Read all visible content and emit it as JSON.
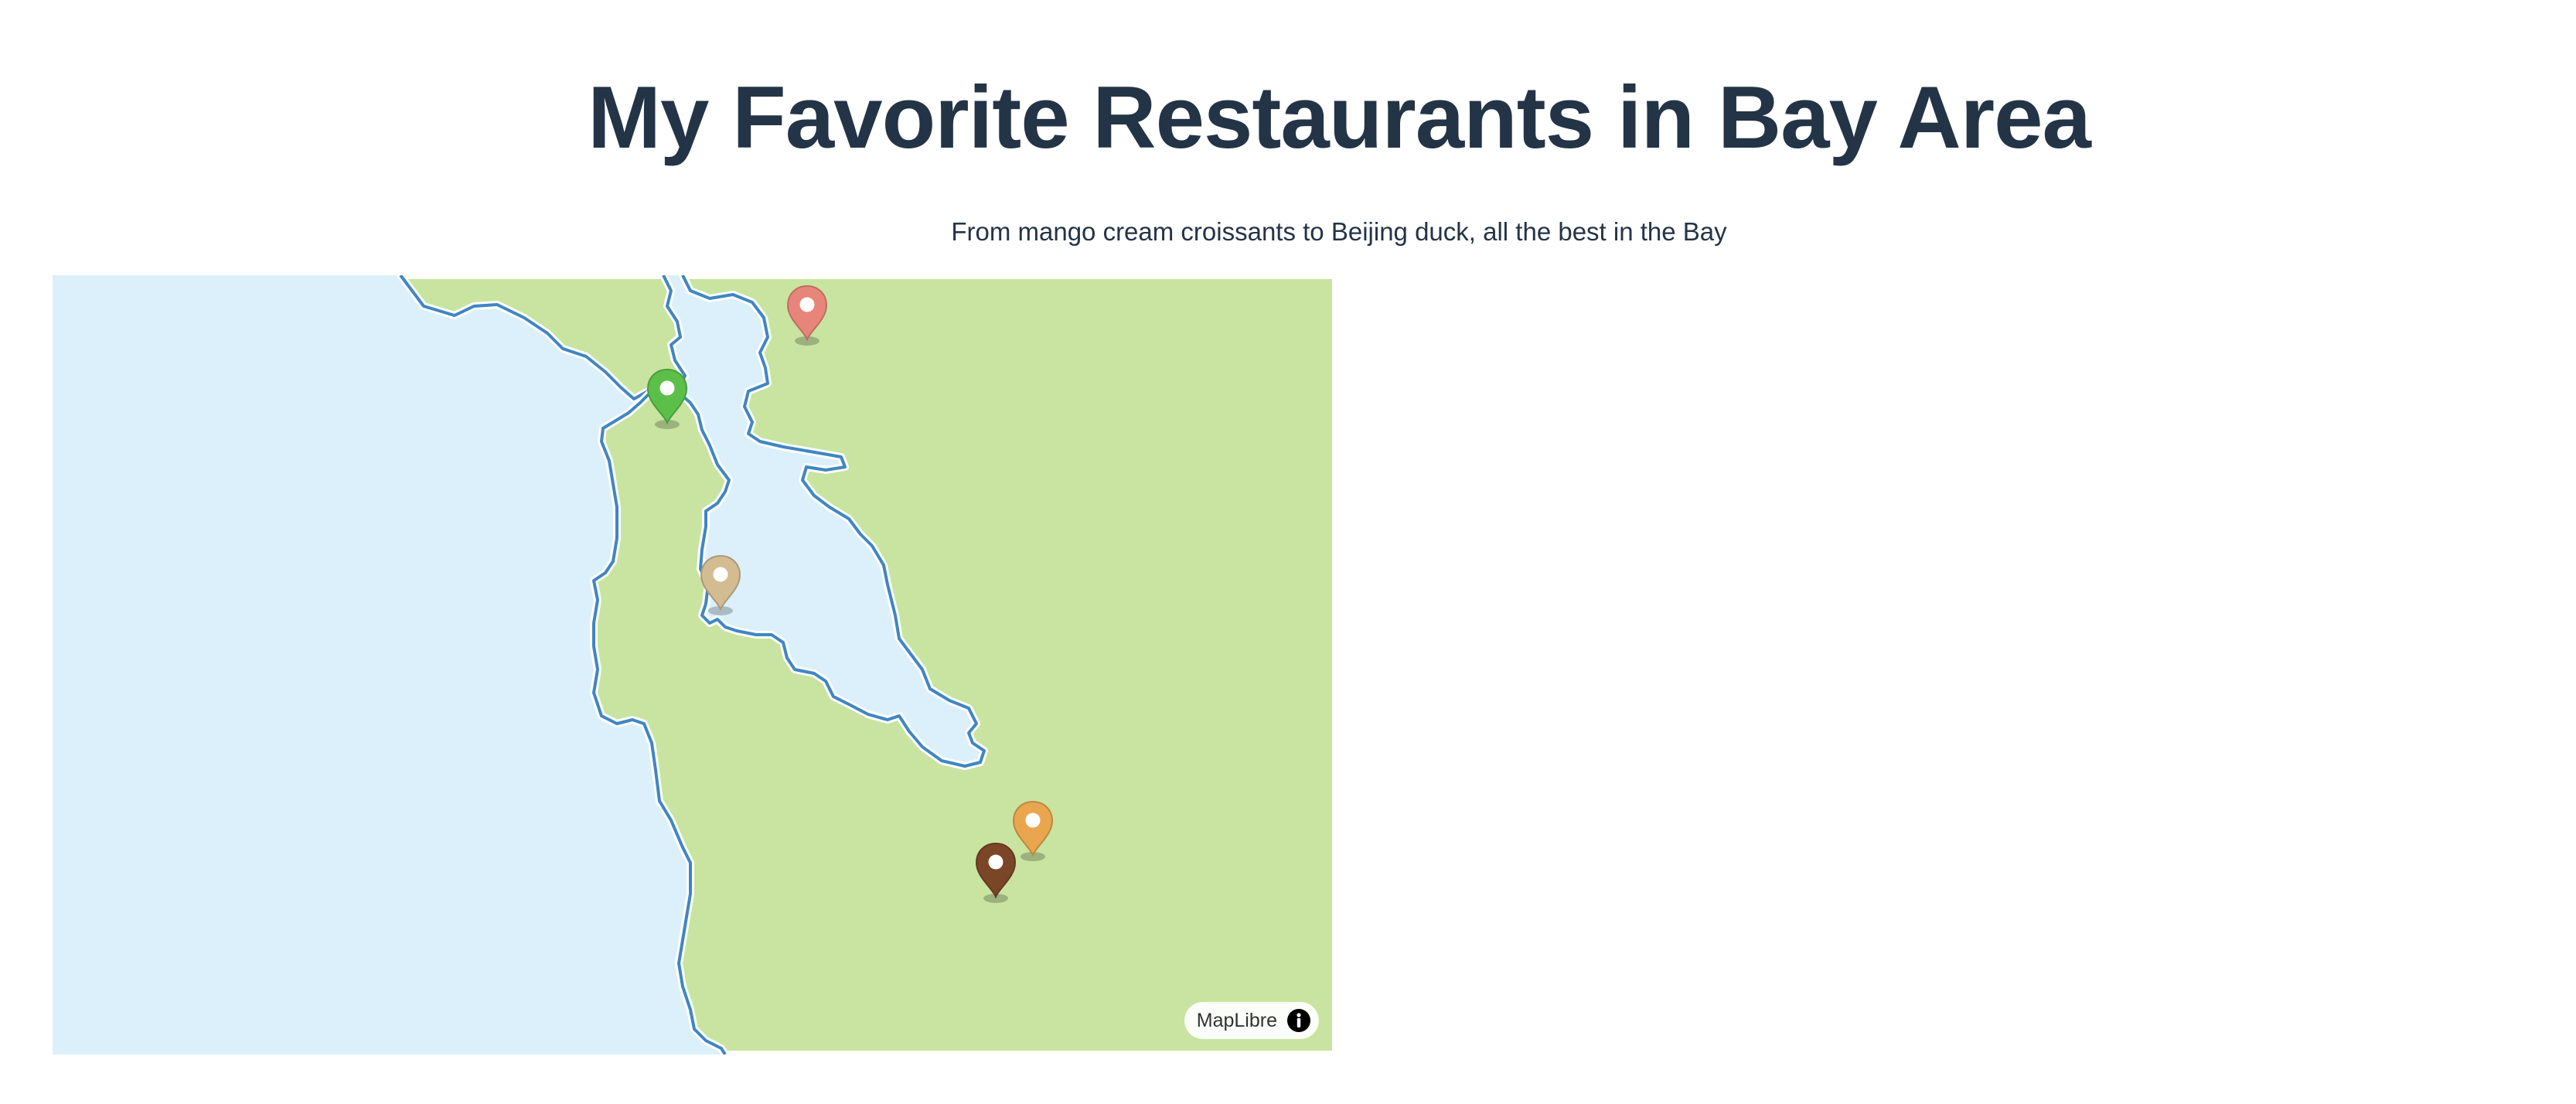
{
  "header": {
    "title": "My Favorite Restaurants in Bay Area",
    "subtitle": "From mango cream croissants to Beijing duck, all the best in the Bay"
  },
  "map": {
    "colors": {
      "water": "#dcf0fb",
      "land": "#c8e4a0",
      "shoreline": "#3f86c4",
      "shoreline_halo": "#ffffff"
    },
    "attribution": {
      "label": "MapLibre",
      "icon": "info-icon"
    },
    "markers": [
      {
        "name": "marker-salmon",
        "color": "#e8857a",
        "icon": "map-pin-icon"
      },
      {
        "name": "marker-green",
        "color": "#5cbf4a",
        "icon": "map-pin-icon"
      },
      {
        "name": "marker-tan",
        "color": "#d3bb92",
        "icon": "map-pin-icon"
      },
      {
        "name": "marker-orange",
        "color": "#e9a64e",
        "icon": "map-pin-icon"
      },
      {
        "name": "marker-brown",
        "color": "#7b4527",
        "icon": "map-pin-icon"
      }
    ]
  }
}
